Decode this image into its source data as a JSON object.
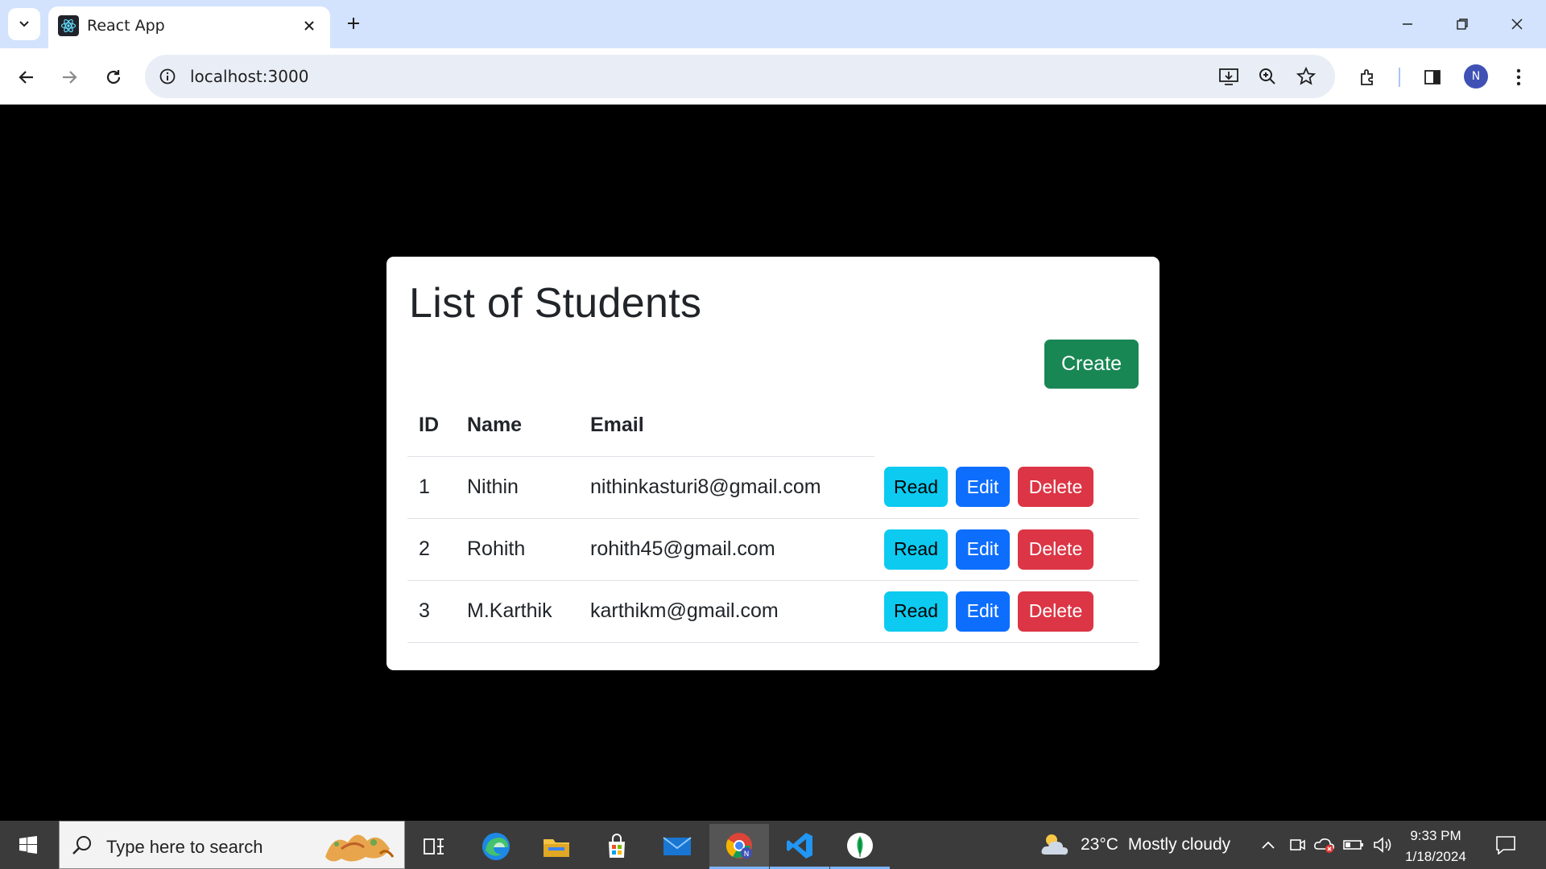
{
  "browser": {
    "tab": {
      "title": "React App"
    },
    "address": {
      "url": "localhost:3000"
    },
    "profile_initial": "N"
  },
  "page": {
    "title": "List of Students",
    "create_label": "Create",
    "columns": [
      "ID",
      "Name",
      "Email"
    ],
    "rows": [
      {
        "id": "1",
        "name": "Nithin",
        "email": "nithinkasturi8@gmail.com"
      },
      {
        "id": "2",
        "name": "Rohith",
        "email": "rohith45@gmail.com"
      },
      {
        "id": "3",
        "name": "M.Karthik",
        "email": "karthikm@gmail.com"
      }
    ],
    "actions": {
      "read": "Read",
      "edit": "Edit",
      "delete": "Delete"
    },
    "colors": {
      "create": "#198754",
      "read": "#0dcaf0",
      "edit": "#0d6efd",
      "delete": "#dc3545"
    }
  },
  "taskbar": {
    "search_placeholder": "Type here to search",
    "weather": {
      "temp": "23°C",
      "condition": "Mostly cloudy"
    },
    "clock": {
      "time": "9:33 PM",
      "date": "1/18/2024"
    }
  }
}
